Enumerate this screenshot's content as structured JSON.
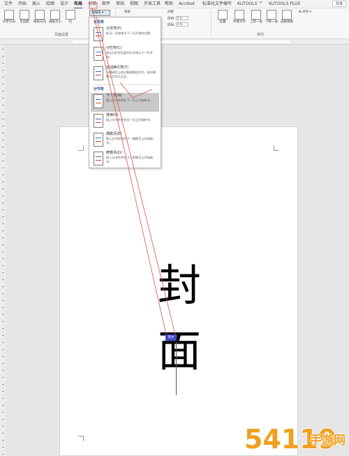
{
  "tabs": [
    "文件",
    "开始",
    "插入",
    "绘图",
    "设计",
    "布局",
    "引用",
    "邮件",
    "审阅",
    "视图",
    "开发工具",
    "帮助",
    "Acrobat",
    "标准化文件编写",
    "KUTOOLS ™",
    "KUTOOLS PLUS"
  ],
  "share_label": "共享",
  "ribbon": {
    "text_direction": "文字方向",
    "margins": "页边距",
    "orientation": "纸张方向",
    "size": "纸张大小",
    "columns": "栏",
    "breaks_button": "分隔符",
    "indent_label": "缩进",
    "spacing_label": "间距",
    "spacing_before": "段前:",
    "spacing_after": "段后:",
    "spacing_before_value": "0 行",
    "spacing_after_value": "0 行",
    "page_setup_group": "页面设置",
    "position": "位置",
    "wrap_text": "环绕文字",
    "bring_forward": "上移一层",
    "send_backward": "下移一层",
    "selection_pane": "选择窗格",
    "align": "对齐",
    "arrange_group": "排列"
  },
  "breaks_menu": {
    "page_breaks_header": "分页符",
    "section_breaks_header": "分节符",
    "items": [
      {
        "title": "分页符(P)",
        "desc": "标记一页结束与下一页开始的位置。"
      },
      {
        "title": "分栏符(C)",
        "desc": "指示分栏符后面的文字将从下一栏开始。"
      },
      {
        "title": "自动换行符(T)",
        "desc": "分隔网页上的对象周围的文字，如分隔题注文字与正文。"
      },
      {
        "title": "下一页(N)",
        "desc": "插入分节符并在下一页上开始新节。"
      },
      {
        "title": "连续(O)",
        "desc": "插入分节符并在同一页上开始新节。"
      },
      {
        "title": "偶数页(E)",
        "desc": "插入分节符并在下一偶数页上开始新节。"
      },
      {
        "title": "奇数页(D)",
        "desc": "插入分节符并在下一奇数页上开始新节。"
      }
    ]
  },
  "document": {
    "char_1": "封",
    "char_2": "面",
    "selection_chip": "英文"
  },
  "watermark": {
    "number": "54119",
    "text": "手游网"
  },
  "colors": {
    "accent": "#2b579a",
    "menu_highlight": "#c9c9c9",
    "annotation_red": "#d9534f",
    "selection_chip": "#3f49c7",
    "watermark_orange": "#f0a020"
  }
}
